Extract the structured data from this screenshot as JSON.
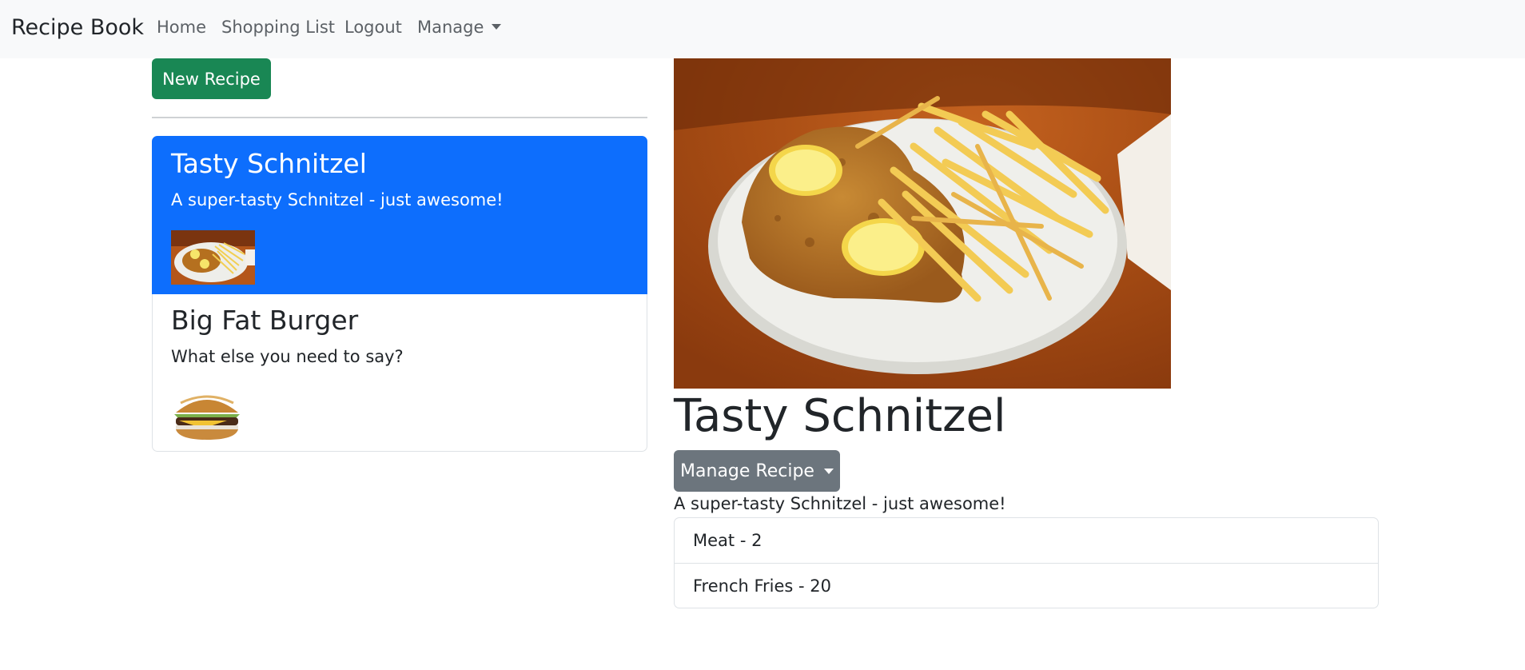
{
  "navbar": {
    "brand": "Recipe Book",
    "links": [
      "Home",
      "Shopping List",
      "Logout"
    ],
    "manage_label": "Manage"
  },
  "sidebar": {
    "new_button": "New Recipe",
    "recipes": [
      {
        "name": "Tasty Schnitzel",
        "description": "A super-tasty Schnitzel - just awesome!",
        "image": "schnitzel-with-fries",
        "active": true
      },
      {
        "name": "Big Fat Burger",
        "description": "What else you need to say?",
        "image": "burger",
        "active": false
      }
    ]
  },
  "detail": {
    "image": "schnitzel-with-fries",
    "name": "Tasty Schnitzel",
    "manage_button": "Manage Recipe",
    "description": "A super-tasty Schnitzel - just awesome!",
    "ingredients": [
      "Meat - 2",
      "French Fries - 20"
    ]
  },
  "colors": {
    "navbar_bg": "#f8f9fa",
    "success": "#198754",
    "primary": "#0d6efd",
    "secondary": "#6c757d"
  }
}
